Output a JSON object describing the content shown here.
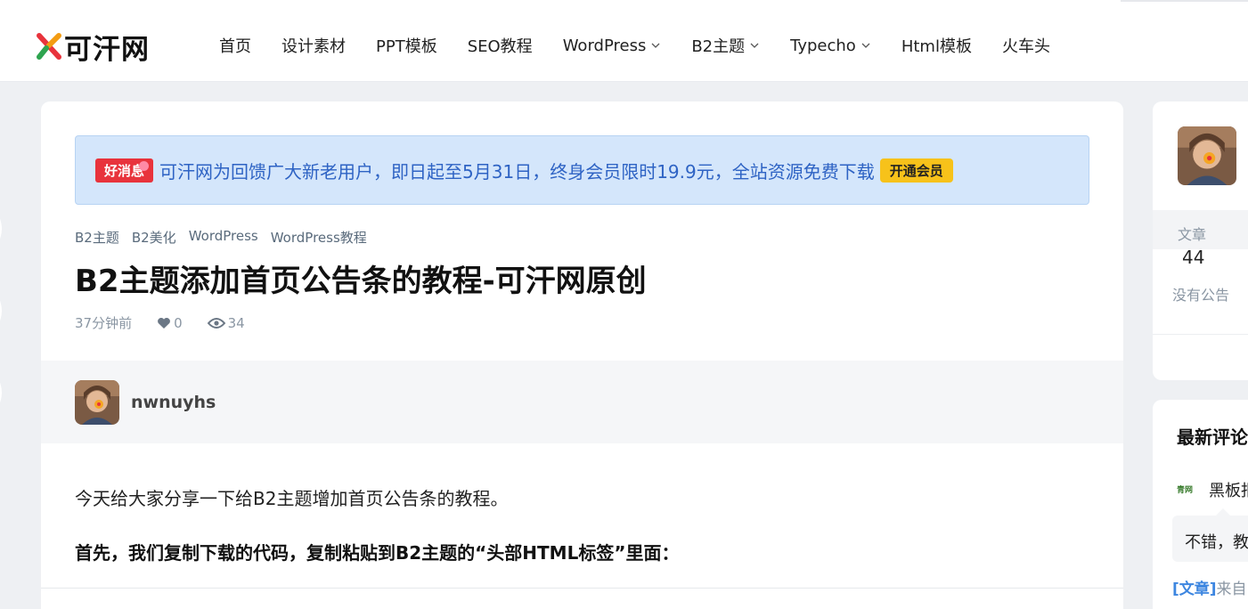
{
  "header": {
    "logo_text": "可汗网",
    "nav": [
      {
        "label": "首页",
        "dropdown": false
      },
      {
        "label": "设计素材",
        "dropdown": false
      },
      {
        "label": "PPT模板",
        "dropdown": false
      },
      {
        "label": "SEO教程",
        "dropdown": false
      },
      {
        "label": "WordPress",
        "dropdown": true
      },
      {
        "label": "B2主题",
        "dropdown": true
      },
      {
        "label": "Typecho",
        "dropdown": true
      },
      {
        "label": "Html模板",
        "dropdown": false
      },
      {
        "label": "火车头",
        "dropdown": false
      }
    ]
  },
  "notice": {
    "tag": "好消息",
    "text": "可汗网为回馈广大新老用户，即日起至5月31日，终身会员限时19.9元，全站资源免费下载",
    "button": "开通会员"
  },
  "post": {
    "categories": [
      "B2主题",
      "B2美化",
      "WordPress",
      "WordPress教程"
    ],
    "title": "B2主题添加首页公告条的教程-可汗网原创",
    "time": "37分钟前",
    "likes": "0",
    "views": "34",
    "author": "nwnuyhs",
    "paragraph1": "今天给大家分享一下给B2主题增加首页公告条的教程。",
    "paragraph2": "首先，我们复制下载的代码，复制粘贴到B2主题的“头部HTML标签”里面："
  },
  "sidebar": {
    "stat_label": "文章",
    "stat_value": "44",
    "notice_text": "没有公告",
    "comments_title": "最新评论",
    "comment_badge": "青网",
    "comment_user": "黑板报",
    "comment_text": "不错，教程",
    "comment_tag": "[文章]",
    "comment_from": "来自："
  },
  "colors": {
    "accent_blue": "#2e63c4",
    "notice_bg": "#d4e6fb",
    "tag_red": "#e8333c",
    "button_yellow": "#f7c21a"
  }
}
